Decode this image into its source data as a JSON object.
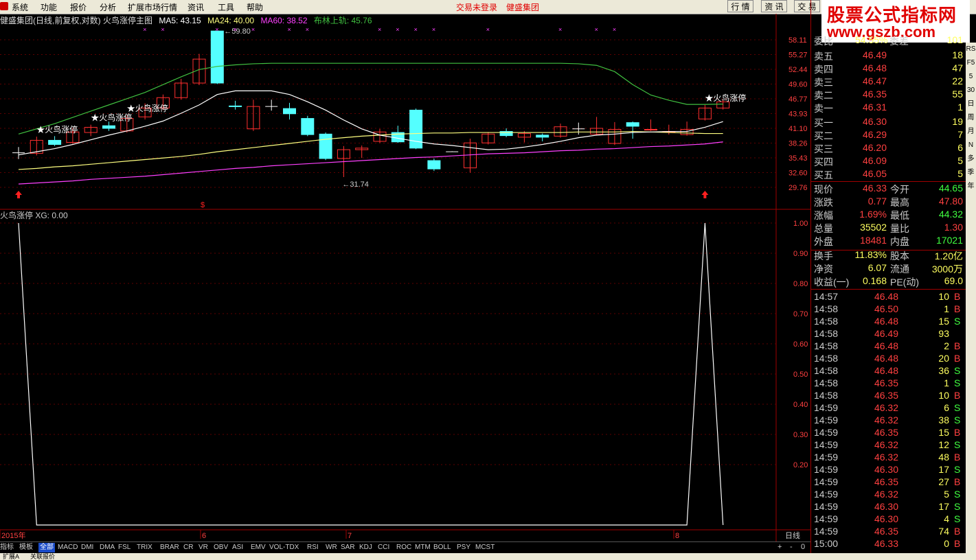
{
  "menu": [
    "系统",
    "功能",
    "报价",
    "分析",
    "扩展市场行情",
    "资讯",
    "工具",
    "帮助"
  ],
  "menu_status": [
    "交易未登录",
    "健盛集团"
  ],
  "top_buttons": [
    "行 情",
    "资 讯",
    "交 易"
  ],
  "watermark": {
    "line1": "股票公式指标网",
    "line2": "www.gszb.com"
  },
  "info": {
    "title": "健盛集团(日线,前复权,对数) 火鸟涨停主图",
    "ma5": "MA5: 43.15",
    "ma24": "MA24: 40.00",
    "ma60": "MA60: 38.52",
    "boll": "布林上轨: 45.76"
  },
  "price_axis": [
    "58.11",
    "55.27",
    "52.44",
    "49.60",
    "46.77",
    "43.93",
    "41.10",
    "38.26",
    "35.43",
    "32.60",
    "29.76"
  ],
  "annotations": {
    "high": "59.80",
    "low": "31.74",
    "signal": "★火鸟涨停"
  },
  "sub": {
    "title": "火鸟涨停 XG: 0.00",
    "axis": [
      "1.00",
      "0.90",
      "0.80",
      "0.70",
      "0.60",
      "0.50",
      "0.40",
      "0.30",
      "0.20"
    ]
  },
  "dates": [
    "2015年",
    "6",
    "7",
    "8"
  ],
  "period": "日线",
  "quote": {
    "header": {
      "label": "委比",
      "value": "54.55%",
      "label2": "委差",
      "value2": "101"
    },
    "sell": [
      [
        "卖五",
        "46.49",
        "18"
      ],
      [
        "卖四",
        "46.48",
        "47"
      ],
      [
        "卖三",
        "46.47",
        "22"
      ],
      [
        "卖二",
        "46.35",
        "55"
      ],
      [
        "卖一",
        "46.31",
        "1"
      ]
    ],
    "buy": [
      [
        "买一",
        "46.30",
        "19"
      ],
      [
        "买二",
        "46.29",
        "7"
      ],
      [
        "买三",
        "46.20",
        "6"
      ],
      [
        "买四",
        "46.09",
        "5"
      ],
      [
        "买五",
        "46.05",
        "5"
      ]
    ],
    "stats": [
      [
        "现价",
        "46.33",
        "今开",
        "44.65"
      ],
      [
        "涨跌",
        "0.77",
        "最高",
        "47.80"
      ],
      [
        "涨幅",
        "1.69%",
        "最低",
        "44.32"
      ],
      [
        "总量",
        "35502",
        "量比",
        "1.30"
      ],
      [
        "外盘",
        "18481",
        "内盘",
        "17021"
      ],
      [
        "换手",
        "11.83%",
        "股本",
        "1.20亿"
      ],
      [
        "净资",
        "6.07",
        "流通",
        "3000万"
      ],
      [
        "收益(一)",
        "0.168",
        "PE(动)",
        "69.0"
      ]
    ],
    "ticks": [
      [
        "14:57",
        "46.48",
        "10",
        "B"
      ],
      [
        "14:58",
        "46.50",
        "1",
        "B"
      ],
      [
        "14:58",
        "46.48",
        "15",
        "S"
      ],
      [
        "14:58",
        "46.49",
        "93",
        ""
      ],
      [
        "14:58",
        "46.48",
        "2",
        "B"
      ],
      [
        "14:58",
        "46.48",
        "20",
        "B"
      ],
      [
        "14:58",
        "46.48",
        "36",
        "S"
      ],
      [
        "14:58",
        "46.35",
        "1",
        "S"
      ],
      [
        "14:58",
        "46.35",
        "10",
        "B"
      ],
      [
        "14:59",
        "46.32",
        "6",
        "S"
      ],
      [
        "14:59",
        "46.32",
        "38",
        "S"
      ],
      [
        "14:59",
        "46.35",
        "15",
        "B"
      ],
      [
        "14:59",
        "46.32",
        "12",
        "S"
      ],
      [
        "14:59",
        "46.32",
        "48",
        "B"
      ],
      [
        "14:59",
        "46.30",
        "17",
        "S"
      ],
      [
        "14:59",
        "46.35",
        "27",
        "B"
      ],
      [
        "14:59",
        "46.32",
        "5",
        "S"
      ],
      [
        "14:59",
        "46.30",
        "17",
        "S"
      ],
      [
        "14:59",
        "46.30",
        "4",
        "S"
      ],
      [
        "14:59",
        "46.35",
        "74",
        "B"
      ],
      [
        "15:00",
        "46.33",
        "0",
        "B"
      ]
    ]
  },
  "tabs": [
    "指标",
    "模板",
    "全部",
    "MACD",
    "DMI",
    "DMA",
    "FSL",
    "TRIX",
    "BRAR",
    "CR",
    "VR",
    "OBV",
    "ASI",
    "EMV",
    "VOL-TDX",
    "RSI",
    "WR",
    "SAR",
    "KDJ",
    "CCI",
    "ROC",
    "MTM",
    "BOLL",
    "PSY",
    "MCST"
  ],
  "bottom_controls": [
    "+",
    "-",
    "0"
  ],
  "statusbar": [
    "扩展A",
    "关联报价"
  ],
  "right_toolbar": [
    "RS",
    "F5",
    "5",
    "30",
    "日",
    "周",
    "月",
    "N",
    "多",
    "季",
    "年"
  ],
  "colors": {
    "up": "#ff3030",
    "down": "#54ffff",
    "ma5": "#ffffff",
    "ma24": "#ffff80",
    "ma60": "#ff40ff",
    "boll": "#40c040"
  },
  "chart_data": {
    "type": "candlestick",
    "dates_label": [
      "2015年",
      "6",
      "7",
      "8"
    ],
    "ylim": [
      29.76,
      58.11
    ],
    "candles": [
      {
        "o": 36.4,
        "c": 36.4,
        "h": 37.5,
        "l": 35.2
      },
      {
        "o": 36.3,
        "c": 38.8,
        "h": 39.5,
        "l": 35.9
      },
      {
        "o": 38.8,
        "c": 38.0,
        "h": 39.6,
        "l": 37.7
      },
      {
        "o": 38.4,
        "c": 40.4,
        "h": 41.2,
        "l": 38.1
      },
      {
        "o": 40.3,
        "c": 41.3,
        "h": 41.8,
        "l": 39.6
      },
      {
        "o": 41.6,
        "c": 41.1,
        "h": 42.4,
        "l": 40.6
      },
      {
        "o": 40.6,
        "c": 43.0,
        "h": 43.6,
        "l": 40.3
      },
      {
        "o": 43.3,
        "c": 45.0,
        "h": 45.9,
        "l": 42.8
      },
      {
        "o": 45.0,
        "c": 47.0,
        "h": 47.6,
        "l": 44.6
      },
      {
        "o": 47.0,
        "c": 49.8,
        "h": 50.6,
        "l": 46.6
      },
      {
        "o": 49.8,
        "c": 54.4,
        "h": 55.4,
        "l": 49.4
      },
      {
        "o": 59.8,
        "c": 49.8,
        "h": 59.8,
        "l": 49.6
      },
      {
        "o": 45.4,
        "c": 45.3,
        "h": 46.4,
        "l": 44.7
      },
      {
        "o": 41.0,
        "c": 45.3,
        "h": 46.6,
        "l": 40.6
      },
      {
        "o": 45.3,
        "c": 45.3,
        "h": 46.6,
        "l": 44.5
      },
      {
        "o": 44.9,
        "c": 43.9,
        "h": 46.0,
        "l": 42.8
      },
      {
        "o": 43.0,
        "c": 39.9,
        "h": 43.5,
        "l": 39.6
      },
      {
        "o": 40.0,
        "c": 35.3,
        "h": 40.3,
        "l": 35.0
      },
      {
        "o": 35.3,
        "c": 37.0,
        "h": 37.7,
        "l": 31.74
      },
      {
        "o": 37.0,
        "c": 37.3,
        "h": 37.8,
        "l": 35.4
      },
      {
        "o": 38.6,
        "c": 40.4,
        "h": 41.0,
        "l": 38.3
      },
      {
        "o": 40.3,
        "c": 38.5,
        "h": 41.6,
        "l": 38.3
      },
      {
        "o": 44.6,
        "c": 37.3,
        "h": 44.9,
        "l": 37.1
      },
      {
        "o": 34.9,
        "c": 33.3,
        "h": 35.3,
        "l": 32.9
      },
      {
        "o": 36.6,
        "c": 36.6,
        "h": 36.7,
        "l": 36.6
      },
      {
        "o": 33.5,
        "c": 38.3,
        "h": 39.1,
        "l": 32.6
      },
      {
        "o": 38.3,
        "c": 40.0,
        "h": 40.4,
        "l": 38.0
      },
      {
        "o": 40.5,
        "c": 39.7,
        "h": 41.1,
        "l": 39.4
      },
      {
        "o": 39.4,
        "c": 40.1,
        "h": 40.6,
        "l": 38.4
      },
      {
        "o": 39.8,
        "c": 39.4,
        "h": 40.1,
        "l": 38.6
      },
      {
        "o": 39.6,
        "c": 41.4,
        "h": 42.0,
        "l": 39.3
      },
      {
        "o": 41.0,
        "c": 41.0,
        "h": 42.2,
        "l": 39.9
      },
      {
        "o": 40.0,
        "c": 41.1,
        "h": 43.3,
        "l": 39.7
      },
      {
        "o": 38.2,
        "c": 40.9,
        "h": 42.3,
        "l": 37.9
      },
      {
        "o": 42.2,
        "c": 41.5,
        "h": 42.4,
        "l": 39.1
      },
      {
        "o": 40.8,
        "c": 40.9,
        "h": 42.8,
        "l": 40.6
      },
      {
        "o": 40.4,
        "c": 40.5,
        "h": 41.8,
        "l": 39.9
      },
      {
        "o": 39.9,
        "c": 40.9,
        "h": 42.4,
        "l": 39.7
      },
      {
        "o": 42.9,
        "c": 45.0,
        "h": 45.6,
        "l": 42.6
      },
      {
        "o": 45.0,
        "c": 46.2,
        "h": 46.6,
        "l": 44.7
      }
    ],
    "ma5": [
      36.0,
      36.6,
      37.2,
      38.0,
      38.9,
      39.8,
      40.6,
      41.5,
      42.5,
      44.0,
      45.6,
      47.6,
      48.3,
      48.3,
      48.3,
      47.6,
      46.2,
      44.6,
      42.7,
      41.0,
      39.8,
      39.2,
      38.6,
      38.1,
      37.8,
      37.4,
      37.0,
      37.1,
      37.5,
      38.0,
      38.6,
      39.3,
      39.8,
      40.0,
      40.3,
      40.4,
      40.5,
      40.5,
      41.3,
      42.4
    ],
    "ma24": [
      33.2,
      33.4,
      33.7,
      33.9,
      34.2,
      34.5,
      34.8,
      35.1,
      35.4,
      35.7,
      36.1,
      36.6,
      37.0,
      37.4,
      37.8,
      38.2,
      38.6,
      39.0,
      39.3,
      39.6,
      39.8,
      40.0,
      40.1,
      40.2,
      40.2,
      40.3,
      40.3,
      40.3,
      40.3,
      40.3,
      40.3,
      40.4,
      40.4,
      40.4,
      40.5,
      40.4,
      40.3,
      40.2,
      40.1,
      40.1
    ],
    "ma60": [
      30.4,
      30.6,
      30.8,
      31.0,
      31.3,
      31.5,
      31.7,
      31.9,
      32.2,
      32.5,
      32.8,
      33.1,
      33.4,
      33.6,
      33.9,
      34.1,
      34.3,
      34.5,
      34.7,
      34.9,
      35.1,
      35.3,
      35.5,
      35.6,
      35.8,
      36.0,
      36.2,
      36.3,
      36.4,
      36.6,
      36.8,
      36.9,
      37.1,
      37.2,
      37.4,
      37.6,
      37.7,
      37.9,
      38.1,
      38.5
    ],
    "boll": [
      40.0,
      41.0,
      42.0,
      43.2,
      44.4,
      45.6,
      46.8,
      48.0,
      49.5,
      51.0,
      52.4,
      53.0,
      53.3,
      53.5,
      53.6,
      53.6,
      53.6,
      53.6,
      53.6,
      53.6,
      53.6,
      53.6,
      53.6,
      53.6,
      53.6,
      53.6,
      53.6,
      53.6,
      53.6,
      53.6,
      53.6,
      53.5,
      53.2,
      52.0,
      49.5,
      47.5,
      46.5,
      45.7,
      45.7,
      45.76
    ],
    "signal_index": [
      1,
      4,
      6,
      38
    ],
    "xg": {
      "type": "line",
      "values": [
        1,
        0,
        0,
        0,
        0,
        0,
        0,
        0,
        0,
        0,
        0,
        0,
        0,
        0,
        0,
        0,
        0,
        0,
        0,
        0,
        0,
        0,
        0,
        0,
        0,
        0,
        0,
        0,
        0,
        0,
        0,
        0,
        0,
        0,
        0,
        0,
        0,
        0,
        1,
        0
      ],
      "ylim": [
        0,
        1
      ]
    }
  }
}
